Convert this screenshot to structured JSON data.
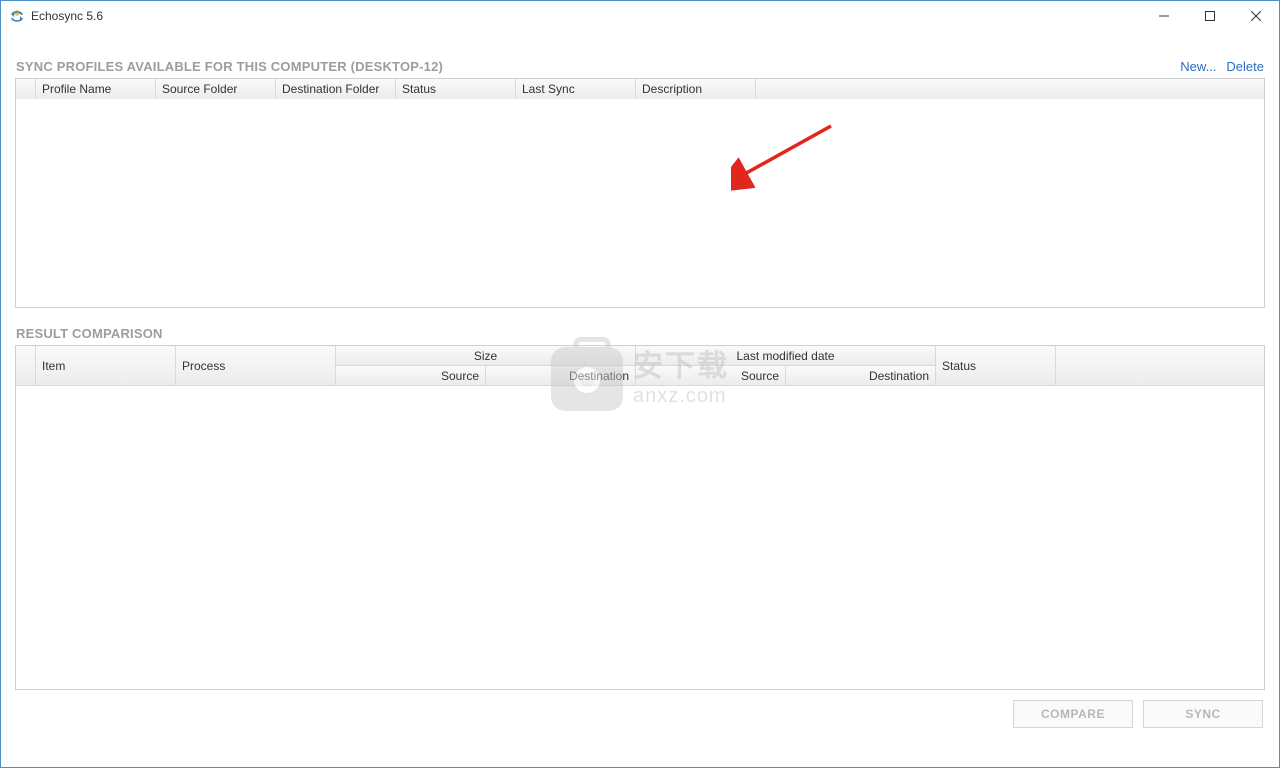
{
  "titlebar": {
    "app_title": "Echosync 5.6"
  },
  "profiles": {
    "header_text": "SYNC PROFILES AVAILABLE FOR THIS COMPUTER (DESKTOP-12)",
    "links": {
      "new": "New...",
      "delete": "Delete"
    },
    "columns": {
      "corner": "",
      "profile_name": "Profile Name",
      "source_folder": "Source Folder",
      "destination_folder": "Destination Folder",
      "status": "Status",
      "last_sync": "Last Sync",
      "description": "Description",
      "filler": ""
    }
  },
  "results": {
    "header_text": "RESULT COMPARISON",
    "columns": {
      "corner": "",
      "item": "Item",
      "process": "Process",
      "size_group": "Size",
      "date_group": "Last modified date",
      "source": "Source",
      "destination": "Destination",
      "status": "Status",
      "filler": ""
    }
  },
  "footer": {
    "compare": "COMPARE",
    "sync": "SYNC"
  },
  "watermark": {
    "cn": "安下载",
    "en": "anxz.com"
  }
}
